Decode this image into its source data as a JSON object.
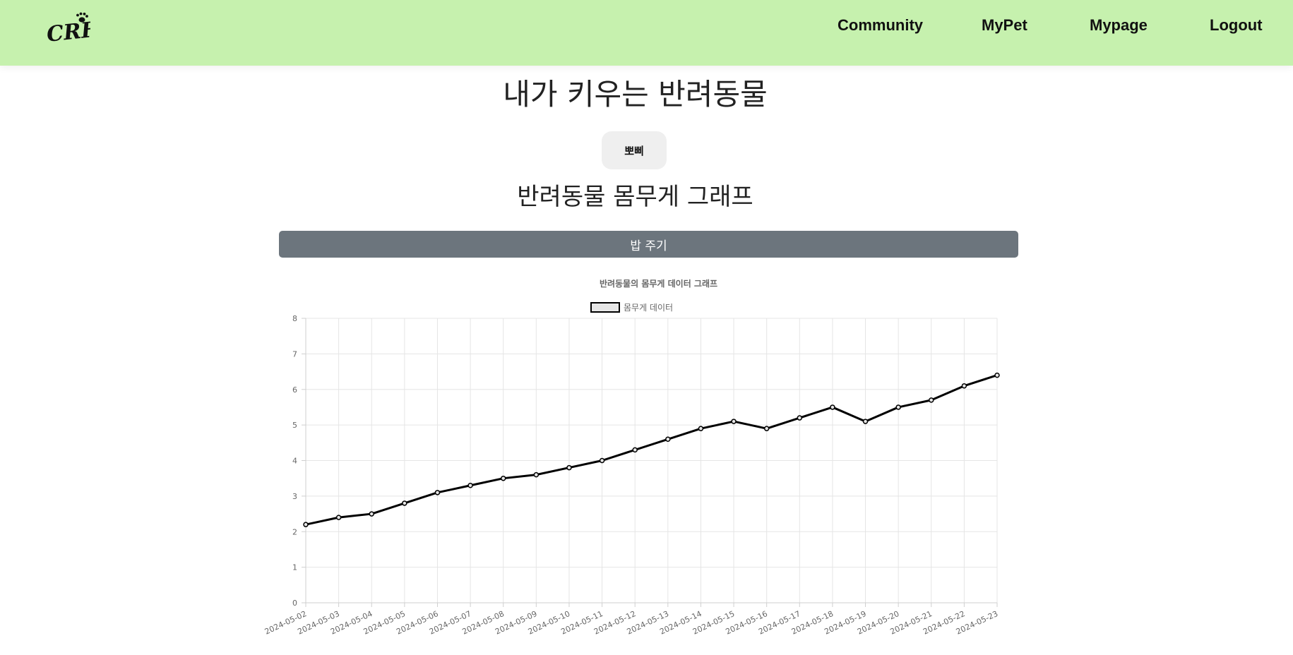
{
  "header": {
    "logo_text": "CRH",
    "nav": [
      "Community",
      "MyPet",
      "Mypage",
      "Logout"
    ]
  },
  "main": {
    "title": "내가 키우는 반려동물",
    "pet_name": "뽀삐",
    "graph_title": "반려동물 몸무게 그래프",
    "feed_button": "밥 주기"
  },
  "colors": {
    "navbar": "#c6f1ae",
    "button_gray": "#6c757d",
    "line": "#000000",
    "grid": "#e5e5e5"
  },
  "chart_data": {
    "type": "line",
    "title": "반려동물의 몸무게 데이터 그래프",
    "legend_position": "top-center",
    "grid": true,
    "ylim": [
      0,
      8
    ],
    "yticks": [
      0,
      1,
      2,
      3,
      4,
      5,
      6,
      7,
      8
    ],
    "x": [
      "2024-05-02",
      "2024-05-03",
      "2024-05-04",
      "2024-05-05",
      "2024-05-06",
      "2024-05-07",
      "2024-05-08",
      "2024-05-09",
      "2024-05-10",
      "2024-05-11",
      "2024-05-12",
      "2024-05-13",
      "2024-05-14",
      "2024-05-15",
      "2024-05-16",
      "2024-05-17",
      "2024-05-18",
      "2024-05-19",
      "2024-05-20",
      "2024-05-21",
      "2024-05-22",
      "2024-05-23"
    ],
    "series": [
      {
        "name": "몸무게 데이터",
        "values": [
          2.2,
          2.4,
          2.5,
          2.8,
          3.1,
          3.3,
          3.5,
          3.6,
          3.8,
          4.0,
          4.3,
          4.6,
          4.9,
          5.1,
          4.9,
          5.2,
          5.5,
          5.1,
          5.5,
          5.7,
          6.1,
          6.4
        ]
      }
    ]
  }
}
